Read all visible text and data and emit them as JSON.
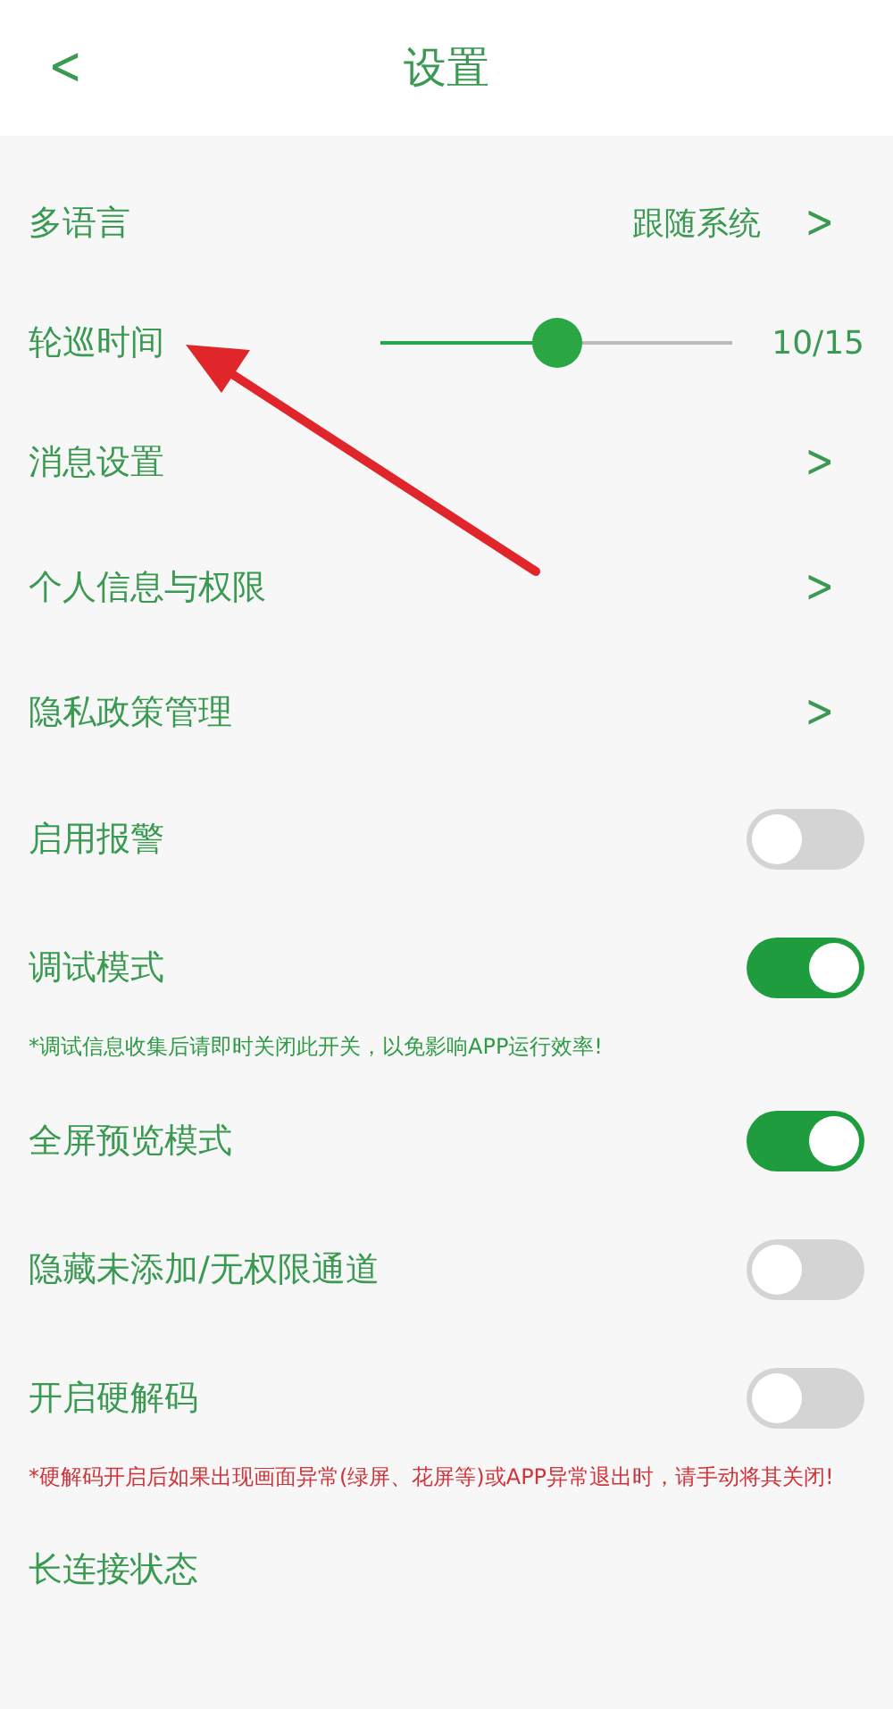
{
  "header": {
    "back": "<",
    "title": "设置"
  },
  "rows": [
    {
      "kind": "link",
      "label": "多语言",
      "value": "跟随系统",
      "chevron": ">"
    },
    {
      "kind": "slider",
      "label": "轮巡时间",
      "level": 0.5,
      "reading": "10/15"
    },
    {
      "kind": "link",
      "label": "消息设置",
      "chevron": ">"
    },
    {
      "kind": "link",
      "label": "个人信息与权限",
      "chevron": ">"
    },
    {
      "kind": "link",
      "label": "隐私政策管理",
      "chevron": ">"
    },
    {
      "kind": "toggle",
      "label": "启用报警",
      "on": false
    },
    {
      "kind": "toggle",
      "label": "调试模式",
      "on": true
    },
    {
      "kind": "note",
      "text": "*调试信息收集后请即时关闭此开关，以免影响APP运行效率!",
      "color": "#2e9b45"
    },
    {
      "kind": "toggle",
      "label": "全屏预览模式",
      "on": true
    },
    {
      "kind": "toggle",
      "label": "隐藏未添加/无权限通道",
      "on": false
    },
    {
      "kind": "toggle",
      "label": "开启硬解码",
      "on": false
    },
    {
      "kind": "note",
      "text": "*硬解码开启后如果出现画面异常(绿屏、花屏等)或APP异常退出时，请手动将其关闭!",
      "color": "#d0343a"
    },
    {
      "kind": "link",
      "label": "长连接状态"
    }
  ],
  "annotation": {
    "kind": "arrow"
  }
}
